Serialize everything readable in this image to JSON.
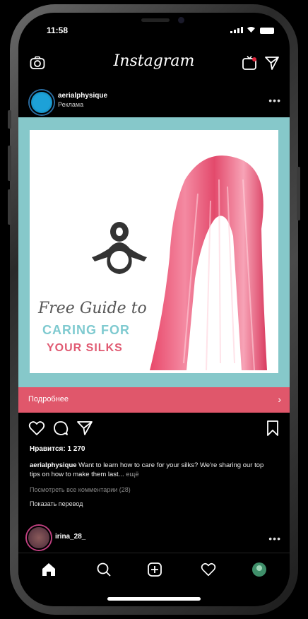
{
  "status_bar": {
    "time": "11:58"
  },
  "header": {
    "title": "Instagram"
  },
  "post": {
    "username": "aerialphysique",
    "sponsored_label": "Реклама",
    "image_text": {
      "line1": "Free Guide to",
      "line2": "CARING FOR",
      "line3": "YOUR SILKS"
    },
    "cta_label": "Подробнее",
    "likes": "Нравится: 1 270",
    "caption_user": "aerialphysique",
    "caption_text": "Want to learn how to care for your silks? We're sharing our top tips on how to make them last...",
    "caption_more": "ещё",
    "view_comments": "Посмотреть все комментарии (28)",
    "show_translation": "Показать перевод"
  },
  "next_post": {
    "username": "irina_28_"
  },
  "colors": {
    "accent_cta": "#e0576b",
    "image_bg": "#86c8ca",
    "teal_text": "#7fcad0",
    "pink_text": "#e05a72"
  }
}
